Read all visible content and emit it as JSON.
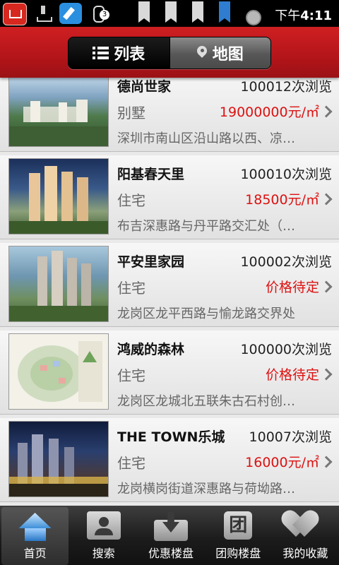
{
  "status_bar": {
    "badge_count": "3",
    "time_prefix": "下午",
    "time": "4:11",
    "icons": [
      "app-icon",
      "download-icon",
      "pen-icon",
      "clipboard-icon",
      "flag-icon",
      "wifi-icon",
      "flag-icon",
      "bookmark-icon",
      "medal-icon"
    ]
  },
  "header": {
    "tab_list": "列表",
    "tab_map": "地图",
    "active_tab": "列表"
  },
  "listings": [
    {
      "name": "德尚世家",
      "views": "100012次浏览",
      "type": "别墅",
      "price": "19000000元/㎡",
      "address": "深圳市南山区沿山路以西、凉…"
    },
    {
      "name": "阳基春天里",
      "views": "100010次浏览",
      "type": "住宅",
      "price": "18500元/㎡",
      "address": "布吉深惠路与丹平路交汇处（…"
    },
    {
      "name": "平安里家园",
      "views": "100002次浏览",
      "type": "住宅",
      "price": "价格待定",
      "address": "龙岗区龙平西路与愉龙路交界处"
    },
    {
      "name": "鸿威的森林",
      "views": "100000次浏览",
      "type": "住宅",
      "price": "价格待定",
      "address": "龙岗区龙城北五联朱古石村创…"
    },
    {
      "name": "THE TOWN乐城",
      "views": "10007次浏览",
      "type": "住宅",
      "price": "16000元/㎡",
      "address": "龙岗横岗街道深惠路与荷坳路…"
    }
  ],
  "tabbar": {
    "home": "首页",
    "search": "搜索",
    "discount": "优惠楼盘",
    "group": "团购楼盘",
    "group_icon_char": "团",
    "favorites": "我的收藏",
    "active": "首页"
  },
  "colors": {
    "header_red": "#c41a1e",
    "price_red": "#dd1111",
    "tab_blue": "#3d8fd8"
  }
}
